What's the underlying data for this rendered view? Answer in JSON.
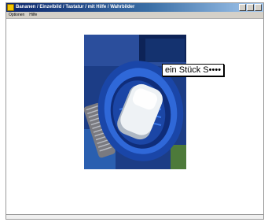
{
  "window": {
    "title": "Bananen / Einzelbild / Tastatur / mit Hilfe / Wahrbilder",
    "icon": "app-icon"
  },
  "menu": {
    "items": [
      "Optionen",
      "Hilfe"
    ]
  },
  "image": {
    "subject": "soap-bar-in-blue-dish"
  },
  "caption": {
    "text": "ein Stück S••••"
  },
  "colors": {
    "titlebar": "#0a246a",
    "dish": "#1e4fb3",
    "soap": "#e9eef2"
  }
}
